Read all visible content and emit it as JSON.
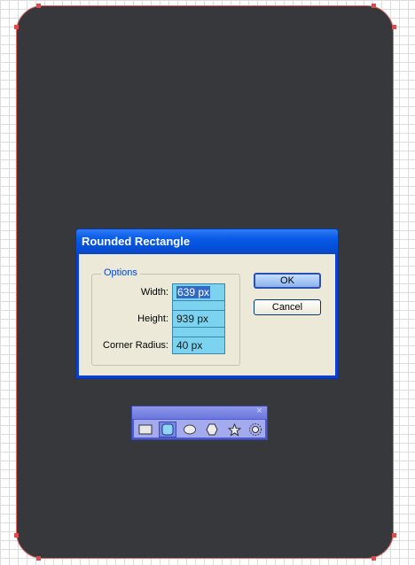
{
  "dialog": {
    "title": "Rounded Rectangle",
    "group_label": "Options",
    "fields": [
      {
        "label": "Width:",
        "value": "639 px"
      },
      {
        "label": "Height:",
        "value": "939 px"
      },
      {
        "label": "Corner Radius:",
        "value": "40 px"
      }
    ],
    "ok_label": "OK",
    "cancel_label": "Cancel"
  },
  "toolbar": {
    "close_glyph": "×",
    "tools": [
      {
        "name": "rectangle-tool",
        "icon": "rectangle-icon"
      },
      {
        "name": "rounded-rectangle-tool",
        "icon": "rounded-rectangle-icon",
        "active": true
      },
      {
        "name": "ellipse-tool",
        "icon": "ellipse-icon"
      },
      {
        "name": "polygon-tool",
        "icon": "polygon-icon"
      },
      {
        "name": "star-tool",
        "icon": "star-icon"
      },
      {
        "name": "flare-tool",
        "icon": "flare-icon"
      }
    ]
  },
  "colors": {
    "canvas_shape": "#36383b",
    "shape_outline": "#e07070",
    "dialog_titlebar": "#0b5ce8",
    "input_fill": "#7cd3f0",
    "selection": "#316ac5"
  }
}
